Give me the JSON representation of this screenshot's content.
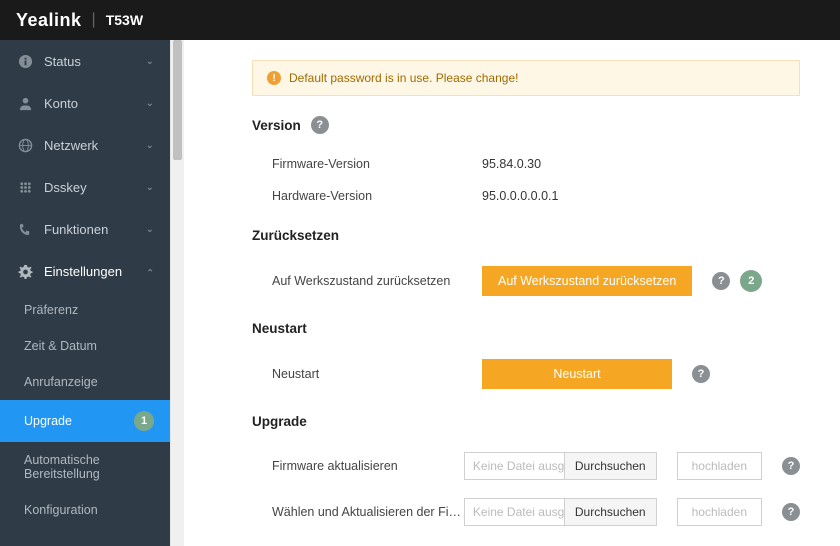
{
  "header": {
    "brand": "Yealink",
    "model": "T53W"
  },
  "sidebar": {
    "items": [
      {
        "label": "Status"
      },
      {
        "label": "Konto"
      },
      {
        "label": "Netzwerk"
      },
      {
        "label": "Dsskey"
      },
      {
        "label": "Funktionen"
      },
      {
        "label": "Einstellungen"
      }
    ],
    "settings_sub": [
      {
        "label": "Präferenz"
      },
      {
        "label": "Zeit & Datum"
      },
      {
        "label": "Anrufanzeige"
      },
      {
        "label": "Upgrade",
        "badge": "1"
      },
      {
        "label": "Automatische Bereitstellung"
      },
      {
        "label": "Konfiguration"
      }
    ]
  },
  "alert": {
    "text": "Default password is in use. Please change!"
  },
  "sections": {
    "version": {
      "title": "Version",
      "firmware_label": "Firmware-Version",
      "firmware_value": "95.84.0.30",
      "hardware_label": "Hardware-Version",
      "hardware_value": "95.0.0.0.0.0.1"
    },
    "reset": {
      "title": "Zurücksetzen",
      "factory_label": "Auf Werkszustand zurücksetzen",
      "factory_button": "Auf Werkszustand zurücksetzen",
      "badge": "2"
    },
    "restart": {
      "title": "Neustart",
      "restart_label": "Neustart",
      "restart_button": "Neustart"
    },
    "upgrade": {
      "title": "Upgrade",
      "firmware_update_label": "Firmware aktualisieren",
      "file_placeholder": "Keine Datei ausg",
      "browse_label": "Durchsuchen",
      "upload_label": "hochladen",
      "select_update_label": "Wählen und Aktualisieren der Firmware de…"
    }
  }
}
